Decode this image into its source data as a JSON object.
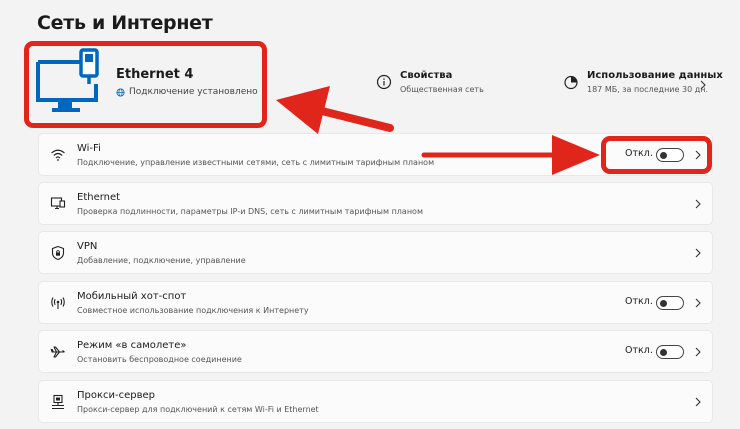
{
  "page": {
    "title": "Сеть и Интернет"
  },
  "hero": {
    "adapter_name": "Ethernet 4",
    "connection_status": "Подключение установлено",
    "properties": {
      "title": "Свойства",
      "subtitle": "Общественная сеть"
    },
    "data_usage": {
      "title": "Использование данных",
      "subtitle": "187 МБ, за последние 30 дн."
    }
  },
  "settings": [
    {
      "icon": "wifi-icon",
      "title": "Wi-Fi",
      "subtitle": "Подключение, управление известными сетями, сеть с лимитным тарифным планом",
      "toggle_label": "Откл.",
      "toggle_on": false
    },
    {
      "icon": "ethernet-icon",
      "title": "Ethernet",
      "subtitle": "Проверка подлинности, параметры IP-и DNS, сеть с лимитным тарифным планом"
    },
    {
      "icon": "vpn-shield-icon",
      "title": "VPN",
      "subtitle": "Добавление, подключение, управление"
    },
    {
      "icon": "hotspot-icon",
      "title": "Мобильный хот-спот",
      "subtitle": "Совместное использование подключения к Интернету",
      "toggle_label": "Откл.",
      "toggle_on": false
    },
    {
      "icon": "airplane-icon",
      "title": "Режим «в самолете»",
      "subtitle": "Остановить беспроводное соединение",
      "toggle_label": "Откл.",
      "toggle_on": false
    },
    {
      "icon": "proxy-icon",
      "title": "Прокси-сервер",
      "subtitle": "Прокси-сервер для подключений к сетям Wi-Fi и Ethernet"
    }
  ],
  "colors": {
    "accent": "#0067c0",
    "annotation": "#e0251b"
  }
}
